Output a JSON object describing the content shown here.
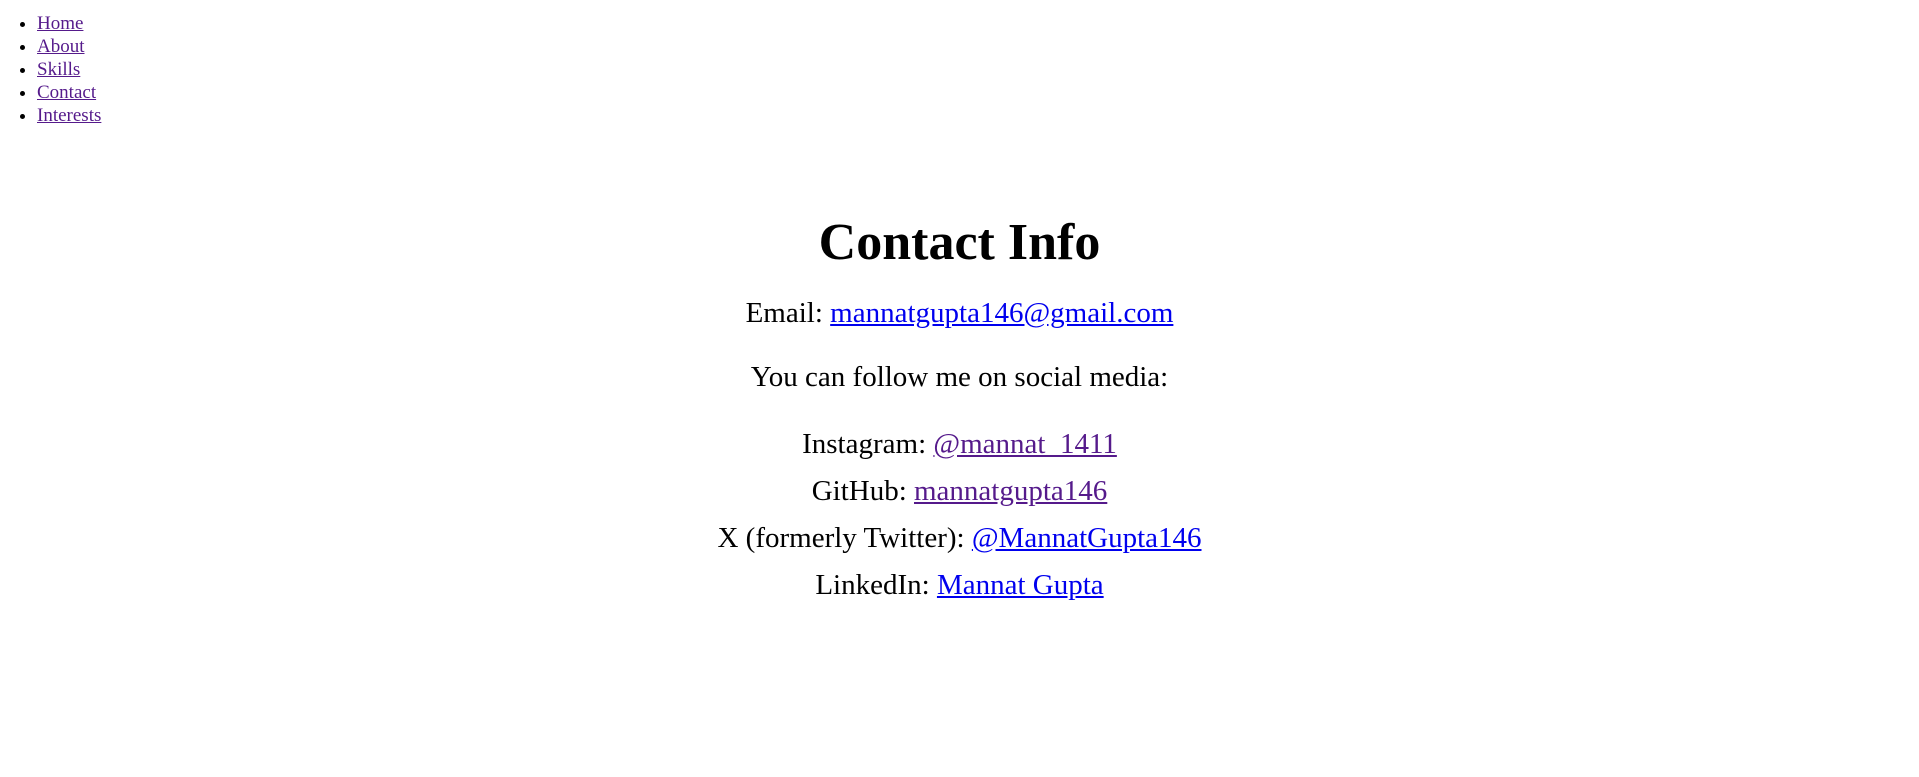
{
  "nav": {
    "items": [
      {
        "label": "Home"
      },
      {
        "label": "About"
      },
      {
        "label": "Skills"
      },
      {
        "label": "Contact"
      },
      {
        "label": "Interests"
      }
    ]
  },
  "contact": {
    "title": "Contact Info",
    "email_label": "Email: ",
    "email_value": "mannatgupta146@gmail.com",
    "follow_text": "You can follow me on social media:",
    "social": [
      {
        "label": "Instagram: ",
        "value": "@mannat_1411"
      },
      {
        "label": "GitHub: ",
        "value": "mannatgupta146"
      },
      {
        "label": "X (formerly Twitter): ",
        "value": "@MannatGupta146"
      },
      {
        "label": "LinkedIn: ",
        "value": "Mannat Gupta"
      }
    ]
  },
  "colors": {
    "link_unvisited": "#0000ee",
    "link_visited": "#551a8b",
    "text": "#000000",
    "background": "#ffffff"
  }
}
